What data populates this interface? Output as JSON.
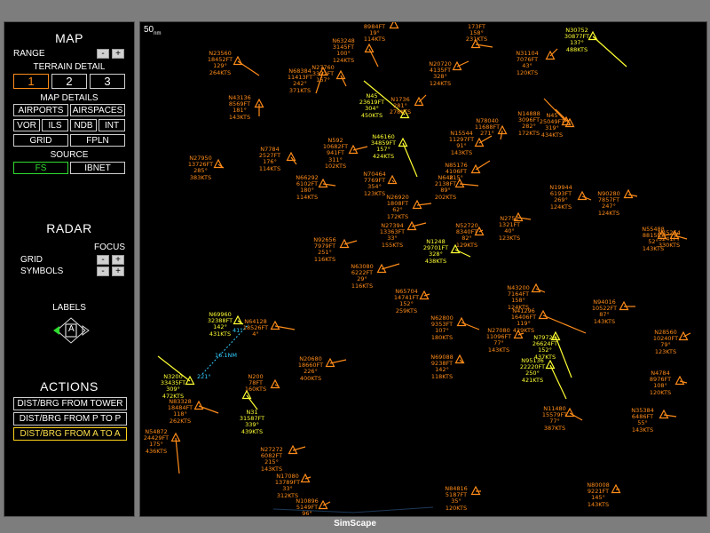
{
  "panel": {
    "map_title": "MAP",
    "range_label": "RANGE",
    "minus": "-",
    "plus": "+",
    "terrain_label": "TERRAIN DETAIL",
    "terrain_options": [
      "1",
      "2",
      "3"
    ],
    "map_details_label": "MAP DETAILS",
    "details": [
      "AIRPORTS",
      "AIRSPACES",
      "VOR",
      "ILS",
      "NDB",
      "INT",
      "GRID",
      "FPLN"
    ],
    "source_label": "SOURCE",
    "source_options": [
      "FS",
      "IBNET"
    ],
    "radar_title": "RADAR",
    "focus_label": "FOCUS",
    "grid_label": "GRID",
    "symbols_label": "SYMBOLS",
    "labels_label": "LABELS",
    "labels_center": "A",
    "actions_title": "ACTIONS",
    "actions": [
      "DIST/BRG FROM TOWER",
      "DIST/BRG FROM P TO P",
      "DIST/BRG FROM A TO A"
    ]
  },
  "radar": {
    "scale": "50",
    "scale_unit": "nm",
    "distance_label": "16.1NM",
    "bearing_label": "221°",
    "bearing_small": "41°"
  },
  "colors": {
    "orange": "#ff8c1a",
    "yellow": "#ffff33",
    "green": "#2fdc2f",
    "cyan": "#33ccff"
  },
  "aircraft": [
    {
      "lines": [
        "8984FT",
        "19°",
        "114KTS"
      ],
      "c": "o"
    },
    {
      "lines": [
        "173FT",
        "158°",
        "231KTS"
      ],
      "c": "o"
    },
    {
      "lines": [
        "N30752",
        "30877FT",
        "137°",
        "488KTS"
      ],
      "c": "y"
    },
    {
      "lines": [
        "N23560",
        "18452FT",
        "129°",
        "264KTS"
      ],
      "c": "o"
    },
    {
      "lines": [
        "N63248",
        "3145FT",
        "100°",
        "124KTS"
      ],
      "c": "o"
    },
    {
      "lines": [
        "N20720",
        "4135FT",
        "328°",
        "124KTS"
      ],
      "c": "o"
    },
    {
      "lines": [
        "N31104",
        "7076FT",
        "43°",
        "120KTS"
      ],
      "c": "o"
    },
    {
      "lines": [
        "N68384",
        "11413FT",
        "242°",
        "371KTS"
      ],
      "c": "o"
    },
    {
      "lines": [
        "N27760",
        "3372FT",
        "167°"
      ],
      "c": "o"
    },
    {
      "lines": [
        "N43136",
        "8569FT",
        "181°",
        "143KTS"
      ],
      "c": "o"
    },
    {
      "lines": [
        "N45",
        "23619FT",
        "304°",
        "450KTS"
      ],
      "c": "y"
    },
    {
      "lines": [
        "N1736",
        "281°",
        "278KTS"
      ],
      "c": "o"
    },
    {
      "lines": [
        "N14888",
        "3096FT",
        "282°",
        "172KTS"
      ],
      "c": "o"
    },
    {
      "lines": [
        "N45",
        "25049FT",
        "319°",
        "434KTS"
      ],
      "c": "o"
    },
    {
      "lines": [
        "N78040",
        "11688FT",
        "271°"
      ],
      "c": "o"
    },
    {
      "lines": [
        "N15544",
        "11297FT",
        "91°",
        "143KTS"
      ],
      "c": "o"
    },
    {
      "lines": [
        "N46160",
        "34859FT",
        "157°",
        "424KTS"
      ],
      "c": "y"
    },
    {
      "lines": [
        "N592",
        "10682FT",
        "941FT",
        "311°",
        "102KTS"
      ],
      "c": "o"
    },
    {
      "lines": [
        "N7784",
        "2527FT",
        "176°",
        "114KTS"
      ],
      "c": "o"
    },
    {
      "lines": [
        "N27950",
        "13726FT",
        "285°",
        "383KTS"
      ],
      "c": "o"
    },
    {
      "lines": [
        "N85176",
        "4106FT",
        "215°"
      ],
      "c": "o"
    },
    {
      "lines": [
        "N648",
        "2138FT",
        "89°",
        "202KTS"
      ],
      "c": "o"
    },
    {
      "lines": [
        "N70464",
        "7769FT",
        "354°",
        "123KTS"
      ],
      "c": "o"
    },
    {
      "lines": [
        "N19944",
        "6193FT",
        "269°",
        "124KTS"
      ],
      "c": "o"
    },
    {
      "lines": [
        "N90280",
        "7857FT",
        "247°",
        "124KTS"
      ],
      "c": "o"
    },
    {
      "lines": [
        "N66292",
        "6102FT",
        "180°",
        "114KTS"
      ],
      "c": "o"
    },
    {
      "lines": [
        "N26920",
        "1808FT",
        "62°",
        "172KTS"
      ],
      "c": "o"
    },
    {
      "lines": [
        "N27394",
        "13363FT",
        "33°",
        "155KTS"
      ],
      "c": "o"
    },
    {
      "lines": [
        "N2752",
        "1321FT",
        "40°",
        "123KTS"
      ],
      "c": "o"
    },
    {
      "lines": [
        "N52720",
        "8340FT",
        "82°",
        "129KTS"
      ],
      "c": "o"
    },
    {
      "lines": [
        "N1248",
        "29701FT",
        "328°",
        "438KTS"
      ],
      "c": "y"
    },
    {
      "lines": [
        "N55488",
        "8815FT",
        "52°",
        "143KTS"
      ],
      "c": "o"
    },
    {
      "lines": [
        "N45264",
        "3241FT",
        "330KTS"
      ],
      "c": "o"
    },
    {
      "lines": [
        "N92656",
        "7979FT",
        "251°",
        "116KTS"
      ],
      "c": "o"
    },
    {
      "lines": [
        "N63080",
        "6222FT",
        "29°",
        "116KTS"
      ],
      "c": "o"
    },
    {
      "lines": [
        "N43200",
        "7164FT",
        "158°",
        "124KTS"
      ],
      "c": "o"
    },
    {
      "lines": [
        "N65704",
        "14741FT",
        "152°",
        "259KTS"
      ],
      "c": "o"
    },
    {
      "lines": [
        "N94016",
        "10522FT",
        "87°",
        "143KTS"
      ],
      "c": "o"
    },
    {
      "lines": [
        "N41296",
        "16406FT",
        "119°",
        "429KTS"
      ],
      "c": "o"
    },
    {
      "lines": [
        "N69960",
        "32388FT",
        "142°",
        "431KTS"
      ],
      "c": "y"
    },
    {
      "lines": [
        "N64128",
        "18526FT",
        "4°"
      ],
      "c": "o"
    },
    {
      "lines": [
        "N62800",
        "9353FT",
        "107°",
        "180KTS"
      ],
      "c": "o"
    },
    {
      "lines": [
        "N27080",
        "11096FT",
        "77°",
        "143KTS"
      ],
      "c": "o"
    },
    {
      "lines": [
        "N79728",
        "26624FT",
        "152°",
        "437KTS"
      ],
      "c": "y"
    },
    {
      "lines": [
        "N28560",
        "10240FT",
        "79°",
        "123KTS"
      ],
      "c": "o"
    },
    {
      "lines": [
        "N69088",
        "9238FT",
        "142°",
        "118KTS"
      ],
      "c": "o"
    },
    {
      "lines": [
        "N95136",
        "22220FT",
        "250°",
        "421KTS"
      ],
      "c": "y"
    },
    {
      "lines": [
        "N20680",
        "18660FT",
        "226°",
        "400KTS"
      ],
      "c": "o"
    },
    {
      "lines": [
        "N4784",
        "8976FT",
        "108°",
        "120KTS"
      ],
      "c": "o"
    },
    {
      "lines": [
        "N3200",
        "33435FT",
        "309°",
        "472KTS"
      ],
      "c": "y"
    },
    {
      "lines": [
        "N83328",
        "18484FT",
        "118°",
        "262KTS"
      ],
      "c": "o"
    },
    {
      "lines": [
        "N200",
        "78FT",
        "160KTS"
      ],
      "c": "o"
    },
    {
      "lines": [
        "N31",
        "31587FT",
        "339°",
        "439KTS"
      ],
      "c": "y"
    },
    {
      "lines": [
        "N11480",
        "15579FT",
        "77°",
        "387KTS"
      ],
      "c": "o"
    },
    {
      "lines": [
        "N35384",
        "6486FT",
        "55°",
        "143KTS"
      ],
      "c": "o"
    },
    {
      "lines": [
        "N54872",
        "24429FT",
        "175°",
        "436KTS"
      ],
      "c": "o"
    },
    {
      "lines": [
        "N27272",
        "6082FT",
        "215°",
        "143KTS"
      ],
      "c": "o"
    },
    {
      "lines": [
        "N17080",
        "13789FT",
        "33°",
        "312KTS"
      ],
      "c": "o"
    },
    {
      "lines": [
        "N84816",
        "5187FT",
        "35°",
        "120KTS"
      ],
      "c": "o"
    },
    {
      "lines": [
        "N80008",
        "9221FT",
        "145°",
        "143KTS"
      ],
      "c": "o"
    },
    {
      "lines": [
        "N10896",
        "5149FT",
        "96°"
      ],
      "c": "o"
    }
  ],
  "footer": {
    "title": "SimScape"
  }
}
